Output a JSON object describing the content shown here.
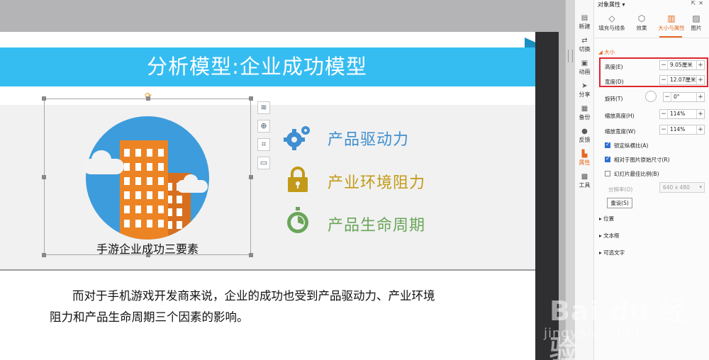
{
  "slide": {
    "title": "分析模型:企业成功模型",
    "image_caption": "手游企业成功三要素",
    "features": [
      {
        "icon": "gears-icon",
        "label": "产品驱动力",
        "color": "#3f8fd1"
      },
      {
        "icon": "padlock-icon",
        "label": "产业环境阻力",
        "color": "#c29a18"
      },
      {
        "icon": "stopwatch-icon",
        "label": "产品生命周期",
        "color": "#6aa55a"
      }
    ],
    "body_line1": "而对于手机游戏开发商来说，企业的成功也受到产品驱动力、产业环境",
    "body_line2": "阻力和产品生命周期三个因素的影响。",
    "banner_color": "#35bdf2",
    "quick_tools": [
      "layers-icon",
      "zoom-icon",
      "crop-icon",
      "picture-settings-icon"
    ]
  },
  "iconbar": {
    "items": [
      {
        "icon": "new-icon",
        "label": "新建"
      },
      {
        "icon": "switch-icon",
        "label": "切换"
      },
      {
        "icon": "animation-icon",
        "label": "动画"
      },
      {
        "icon": "share-icon",
        "label": "分享"
      },
      {
        "icon": "backup-icon",
        "label": "备份"
      },
      {
        "icon": "feedback-icon",
        "label": "反馈"
      },
      {
        "icon": "properties-icon",
        "label": "属性",
        "active": true
      },
      {
        "icon": "tools-icon",
        "label": "工具"
      }
    ]
  },
  "panel": {
    "title": "对象属性",
    "tabs": [
      {
        "icon": "fill-line-icon",
        "label": "填充与线条"
      },
      {
        "icon": "effect-icon",
        "label": "效果"
      },
      {
        "icon": "size-property-icon",
        "label": "大小与属性",
        "active": true
      },
      {
        "icon": "picture-icon",
        "label": "图片"
      }
    ],
    "size_section": "大小",
    "height_label": "高度(E)",
    "height_value": "9.05厘米",
    "width_label": "宽度(D)",
    "width_value": "12.07厘米",
    "rotation_label": "旋转(T)",
    "rotation_value": "0°",
    "scale_h_label": "缩放高度(H)",
    "scale_h_value": "114%",
    "scale_w_label": "缩放宽度(W)",
    "scale_w_value": "114%",
    "lock_ratio_label": "锁定纵横比(A)",
    "lock_ratio_checked": true,
    "relative_label": "相对于图片原始尺寸(R)",
    "relative_checked": true,
    "best_scale_label": "幻灯片最佳比例(B)",
    "best_scale_checked": false,
    "resolution_label": "分辨率(O)",
    "resolution_value": "640 x 480",
    "reset_label": "重设(S)",
    "collapsed_sections": [
      "位置",
      "文本框",
      "可选文字"
    ],
    "highlight_color": "#e0262c",
    "accent_color": "#e6671e"
  },
  "watermark": {
    "main": "Bai du 经验",
    "sub": "jingyan.baidu.com"
  }
}
